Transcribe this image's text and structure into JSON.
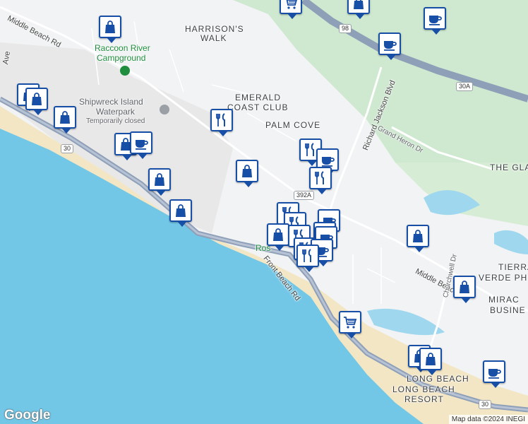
{
  "labels": {
    "middle_beach_rd_nw": "Middle Beach Rd",
    "harrisons_walk_1": "HARRISON'S",
    "harrisons_walk_2": "WALK",
    "raccoon_river_1": "Raccoon River",
    "raccoon_river_2": "Campground",
    "emerald_1": "EMERALD",
    "emerald_2": "COAST CLUB",
    "palm_cove": "PALM COVE",
    "shipwreck_1": "Shipwreck Island",
    "shipwreck_2": "Waterpark",
    "shipwreck_3": "Temporarily closed",
    "richard_jackson": "Richard Jackson Blvd",
    "grand_heron": "Grand Heron Dr",
    "the_gla": "THE GLA",
    "tierra_1": "TIERRA",
    "tierra_2": "VERDE PH",
    "miracle_1": "MIRAC",
    "miracle_2": "BUSINE",
    "middle_beach_rd_se": "Middle Beach Rd",
    "front_beach_rd": "Front Beach Rd",
    "long_beach": "LONG BEACH",
    "long_beach_resort_1": "LONG BEACH",
    "long_beach_resort_2": "RESORT",
    "churchwell": "Churchwell Dr",
    "ros": "Ros",
    "ave": "Ave"
  },
  "shields": {
    "us98": "98",
    "r30a": "30A",
    "r392a": "392A",
    "r30_left": "30",
    "r30_bottom": "30"
  },
  "branding": {
    "logo": "Google",
    "attribution": "Map data ©2024 INEGI"
  },
  "markers": [
    {
      "type": "cart"
    },
    {
      "type": "shopping"
    },
    {
      "type": "coffee"
    },
    {
      "type": "coffee"
    },
    {
      "type": "shopping"
    },
    {
      "type": "shopping"
    },
    {
      "type": "shopping"
    },
    {
      "type": "shopping"
    },
    {
      "type": "restaurant"
    },
    {
      "type": "shopping"
    },
    {
      "type": "coffee"
    },
    {
      "type": "restaurant"
    },
    {
      "type": "coffee"
    },
    {
      "type": "shopping"
    },
    {
      "type": "restaurant"
    },
    {
      "type": "shopping"
    },
    {
      "type": "shopping"
    },
    {
      "type": "restaurant"
    },
    {
      "type": "coffee"
    },
    {
      "type": "restaurant"
    },
    {
      "type": "coffee"
    },
    {
      "type": "shopping"
    },
    {
      "type": "restaurant"
    },
    {
      "type": "coffee"
    },
    {
      "type": "restaurant"
    },
    {
      "type": "coffee"
    },
    {
      "type": "restaurant"
    },
    {
      "type": "shopping"
    },
    {
      "type": "shopping"
    },
    {
      "type": "cart"
    },
    {
      "type": "shopping"
    },
    {
      "type": "shopping"
    },
    {
      "type": "coffee"
    }
  ],
  "colors": {
    "water": "#72c7e7",
    "sand": "#f3e6c4",
    "green": "#c8e6c9",
    "land": "#f1f3f4",
    "highway": "#8e9fb8",
    "marker_blue": "#174ea6"
  }
}
